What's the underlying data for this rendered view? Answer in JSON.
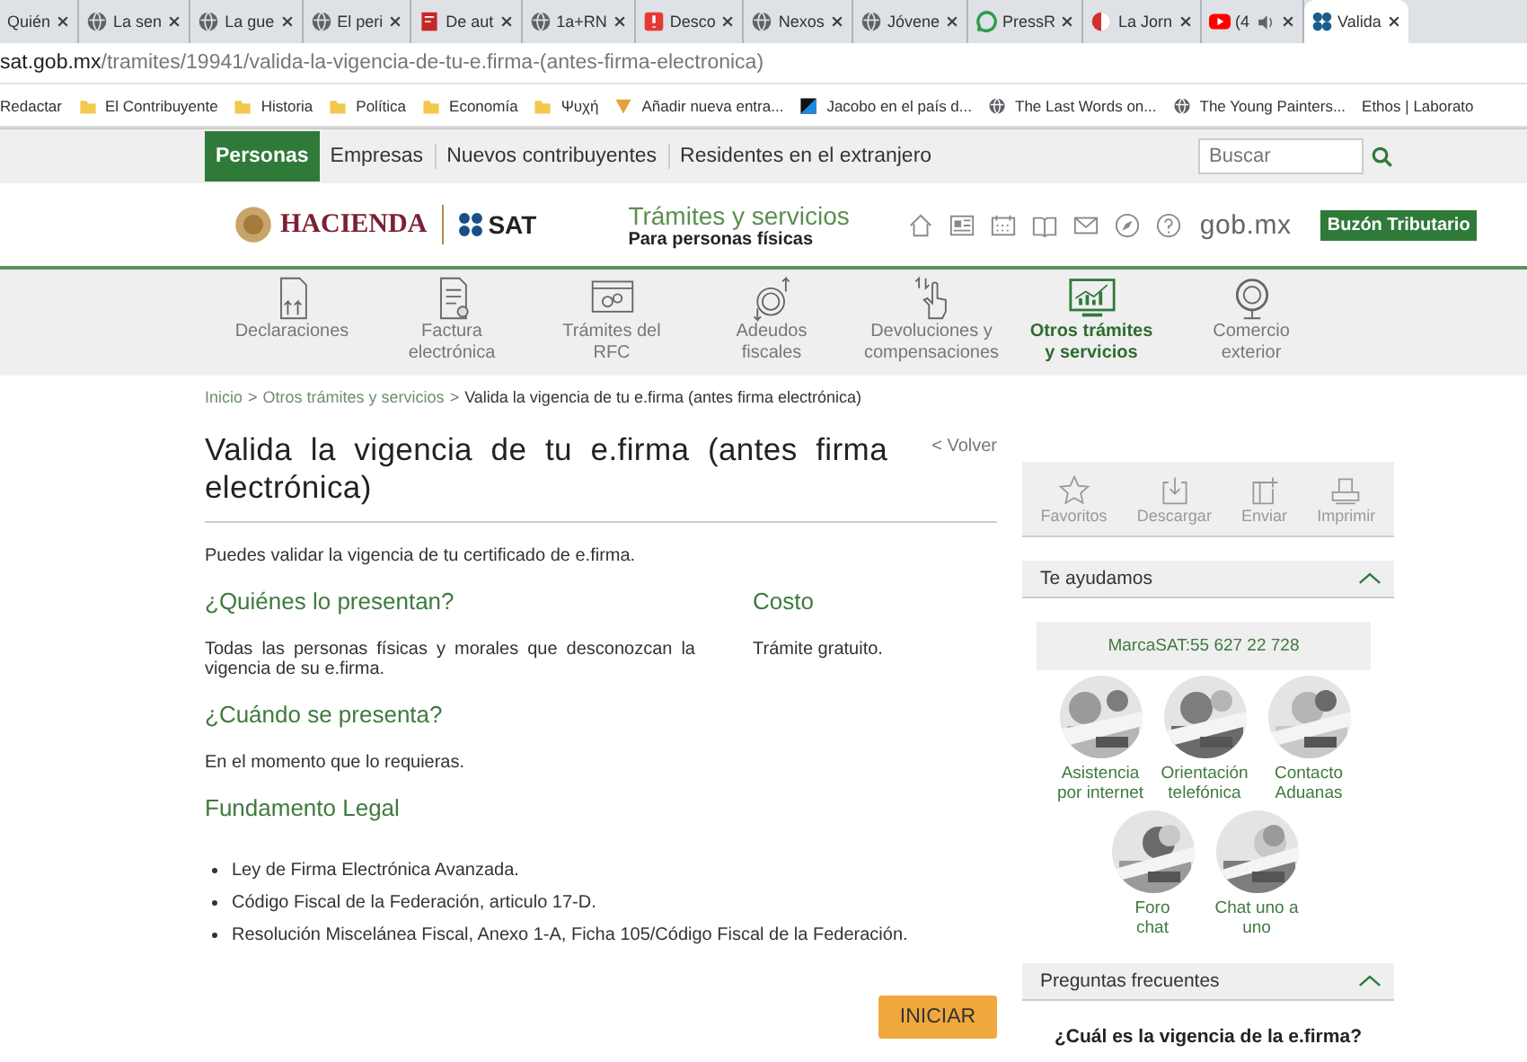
{
  "browser": {
    "tabs": [
      {
        "title": "Quién",
        "kind": "none",
        "selected": false
      },
      {
        "title": "La sen",
        "kind": "globe",
        "selected": false
      },
      {
        "title": "La gue",
        "kind": "globe",
        "selected": false
      },
      {
        "title": "El peri",
        "kind": "globe",
        "selected": false
      },
      {
        "title": "De aut",
        "kind": "doc",
        "selected": false
      },
      {
        "title": "1a+RN",
        "kind": "globe",
        "selected": false
      },
      {
        "title": "Desco",
        "kind": "alert",
        "selected": false
      },
      {
        "title": "Nexos",
        "kind": "globe",
        "selected": false
      },
      {
        "title": "Jóvene",
        "kind": "globe",
        "selected": false
      },
      {
        "title": "PressR",
        "kind": "speech",
        "selected": false
      },
      {
        "title": "La Jorn",
        "kind": "half",
        "selected": false
      },
      {
        "title": "(4",
        "kind": "video",
        "audio": true,
        "selected": false
      },
      {
        "title": "Valida",
        "kind": "dots",
        "selected": true
      }
    ],
    "address": {
      "host": "sat.gob.mx",
      "path": "/tramites/19941/valida-la-vigencia-de-tu-e.firma-(antes-firma-electronica)"
    },
    "bookmarks": [
      {
        "label": "Redactar",
        "kind": "none"
      },
      {
        "label": "El Contribuyente",
        "kind": "folder"
      },
      {
        "label": "Historia",
        "kind": "folder"
      },
      {
        "label": "Política",
        "kind": "folder"
      },
      {
        "label": "Economía",
        "kind": "folder"
      },
      {
        "label": "Ψυχή",
        "kind": "folder"
      },
      {
        "label": "Añadir nueva entra...",
        "kind": "pen"
      },
      {
        "label": "Jacobo en el país d...",
        "kind": "square"
      },
      {
        "label": "The Last Words on...",
        "kind": "globe"
      },
      {
        "label": "The Young Painters...",
        "kind": "globe"
      },
      {
        "label": "Ethos | Laborato",
        "kind": "none"
      }
    ]
  },
  "site": {
    "top_nav": [
      {
        "label": "Personas",
        "selected": true
      },
      {
        "label": "Empresas",
        "selected": false
      },
      {
        "label": "Nuevos contribuyentes",
        "selected": false
      },
      {
        "label": "Residentes en el extranjero",
        "selected": false
      }
    ],
    "search": {
      "placeholder": "Buscar"
    },
    "header": {
      "hacienda": "HACIENDA",
      "sat": "SAT",
      "title": "Trámites y servicios",
      "subtitle": "Para personas físicas",
      "gob": "gob.mx",
      "mailbox_button": "Buzón Tributario"
    },
    "main_nav": [
      {
        "lines": [
          "Declaraciones"
        ],
        "kind": "declaraciones",
        "selected": false
      },
      {
        "lines": [
          "Factura",
          "electrónica"
        ],
        "kind": "factura",
        "selected": false
      },
      {
        "lines": [
          "Trámites del",
          "RFC"
        ],
        "kind": "rfc",
        "selected": false
      },
      {
        "lines": [
          "Adeudos",
          "fiscales"
        ],
        "kind": "adeudos",
        "selected": false
      },
      {
        "lines": [
          "Devoluciones y",
          "compensaciones"
        ],
        "kind": "devoluciones",
        "selected": false
      },
      {
        "lines": [
          "Otros trámites",
          "y servicios"
        ],
        "kind": "otros",
        "selected": true
      },
      {
        "lines": [
          "Comercio",
          "exterior"
        ],
        "kind": "comercio",
        "selected": false
      }
    ],
    "breadcrumb": [
      {
        "label": "Inicio",
        "kind": "link"
      },
      {
        "label": ">",
        "kind": "separator"
      },
      {
        "label": "Otros trámites y servicios",
        "kind": "link"
      },
      {
        "label": ">",
        "kind": "separator"
      },
      {
        "label": "Valida la vigencia de tu e.firma (antes firma electrónica)",
        "kind": "current"
      }
    ],
    "title": "Valida la vigencia de tu e.firma (antes firma electrónica)",
    "back_link": "< Volver",
    "intro": "Puedes validar la vigencia de tu certificado de e.firma.",
    "who": {
      "heading": "¿Quiénes lo presentan?",
      "text": "Todas las personas físicas y morales que desconozcan la vigencia de su e.firma."
    },
    "cost": {
      "heading": "Costo",
      "text": "Trámite gratuito."
    },
    "when": {
      "heading": "¿Cuándo se presenta?",
      "text": "En el momento que lo requieras."
    },
    "legal": {
      "heading": "Fundamento Legal",
      "items": [
        "Ley de Firma Electrónica Avanzada.",
        "Código Fiscal de la Federación, articulo 17-D.",
        "Resolución Miscelánea Fiscal, Anexo 1-A, Ficha 105/Código Fiscal de la Federación."
      ]
    },
    "start_button": "INICIAR",
    "actions": [
      {
        "label": "Favoritos",
        "kind": "star"
      },
      {
        "label": "Descargar",
        "kind": "download"
      },
      {
        "label": "Enviar",
        "kind": "send"
      },
      {
        "label": "Imprimir",
        "kind": "print"
      }
    ],
    "help": {
      "title": "Te ayudamos",
      "expanded": true,
      "phone": "MarcaSAT:55 627 22 728",
      "items": [
        {
          "lines": [
            "Asistencia",
            "por internet"
          ],
          "kind": "picture"
        },
        {
          "lines": [
            "Orientación",
            "telefónica"
          ],
          "kind": "picture"
        },
        {
          "lines": [
            "Contacto",
            "Aduanas"
          ],
          "kind": "picture"
        },
        {
          "lines": [
            "Foro",
            "chat"
          ],
          "kind": "picture"
        },
        {
          "lines": [
            "Chat uno a",
            "uno"
          ],
          "kind": "picture"
        }
      ]
    },
    "faq": {
      "title": "Preguntas frecuentes",
      "expanded": true,
      "first_question": "¿Cuál es la vigencia de la e.firma?"
    }
  }
}
